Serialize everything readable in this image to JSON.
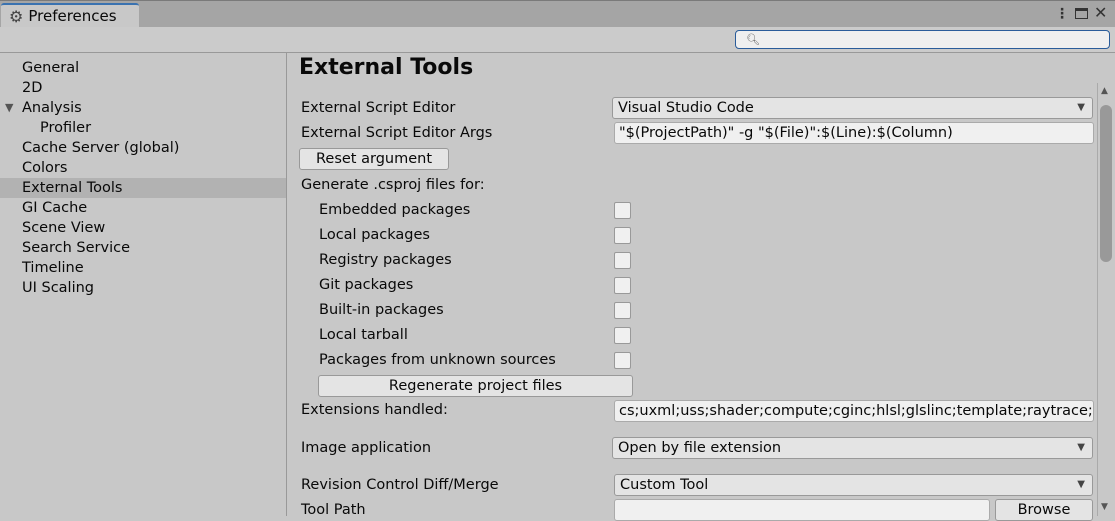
{
  "window": {
    "title": "Preferences",
    "search_placeholder": ""
  },
  "sidebar": {
    "items": [
      "General",
      "2D",
      "Analysis",
      "Profiler",
      "Cache Server (global)",
      "Colors",
      "External Tools",
      "GI Cache",
      "Scene View",
      "Search Service",
      "Timeline",
      "UI Scaling"
    ],
    "selected": "External Tools"
  },
  "main": {
    "title": "External Tools",
    "script_editor_label": "External Script Editor",
    "script_editor_value": "Visual Studio Code",
    "args_label": "External Script Editor Args",
    "args_value": "\"$(ProjectPath)\" -g \"$(File)\":$(Line):$(Column)",
    "reset_button": "Reset argument",
    "generate_label": "Generate .csproj files for:",
    "packages": [
      {
        "label": "Embedded packages",
        "checked": false
      },
      {
        "label": "Local packages",
        "checked": false
      },
      {
        "label": "Registry packages",
        "checked": false
      },
      {
        "label": "Git packages",
        "checked": false
      },
      {
        "label": "Built-in packages",
        "checked": false
      },
      {
        "label": "Local tarball",
        "checked": false
      },
      {
        "label": "Packages from unknown sources",
        "checked": false
      }
    ],
    "regenerate_button": "Regenerate project files",
    "extensions_label": "Extensions handled:",
    "extensions_value": "cs;uxml;uss;shader;compute;cginc;hlsl;glslinc;template;raytrace;tx",
    "image_app_label": "Image application",
    "image_app_value": "Open by file extension",
    "revision_label": "Revision Control Diff/Merge",
    "revision_value": "Custom Tool",
    "tool_path_label": "Tool Path",
    "tool_path_value": "",
    "browse_button": "Browse"
  }
}
